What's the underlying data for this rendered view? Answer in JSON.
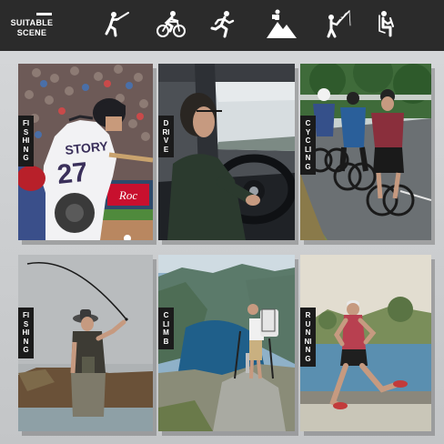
{
  "header": {
    "title_line1": "SUITABLE",
    "title_line2": "SCENE",
    "icons": [
      "baseball-batter-icon",
      "cyclist-icon",
      "runner-icon",
      "hiker-mountain-icon",
      "fisherman-icon",
      "driver-icon"
    ]
  },
  "cards": [
    {
      "name": "baseball",
      "label": "FISHING",
      "jersey_name": "STORY",
      "jersey_number": "27",
      "sign_text": "Roc"
    },
    {
      "name": "drive",
      "label": "DRIVE"
    },
    {
      "name": "cycling",
      "label": "CYCLING"
    },
    {
      "name": "fishing",
      "label": "FISHING"
    },
    {
      "name": "climb",
      "label": "CLIMB"
    },
    {
      "name": "running",
      "label": "RUNNING"
    }
  ],
  "colors": {
    "header_bg": "#2b2b2b",
    "label_bg": "#1b1b1b",
    "page_bg": "#c9cbcd"
  }
}
